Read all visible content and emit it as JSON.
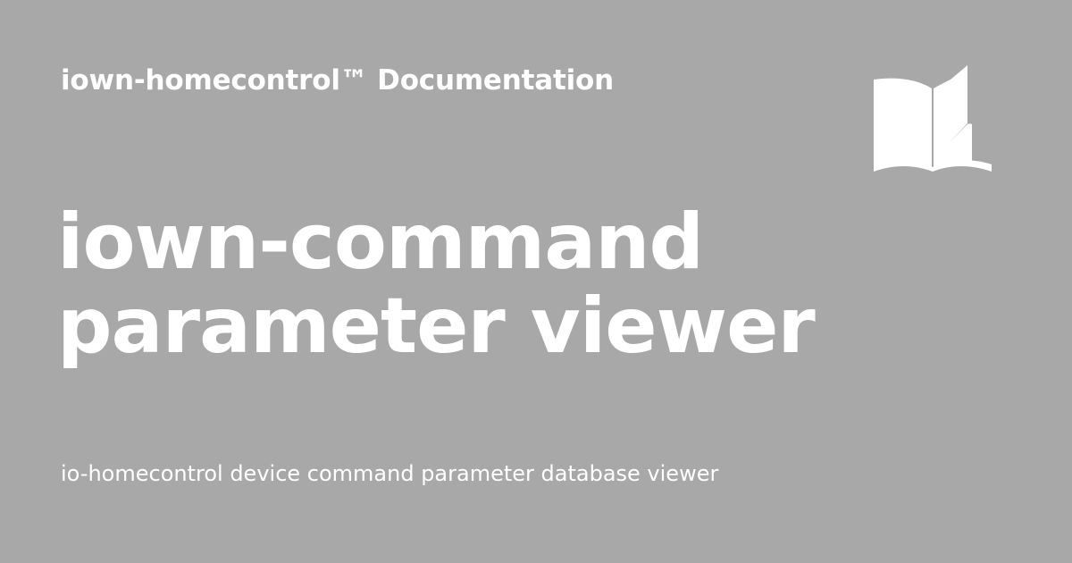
{
  "colors": {
    "background": "#a8a8a8",
    "foreground": "#ffffff"
  },
  "header": {
    "site_name": "iown-homecontrol™ Documentation",
    "icon": "book-open-icon"
  },
  "main": {
    "title_line_1": "iown-command",
    "title_line_2": "parameter viewer",
    "description": "io-homecontrol device command parameter database viewer"
  }
}
